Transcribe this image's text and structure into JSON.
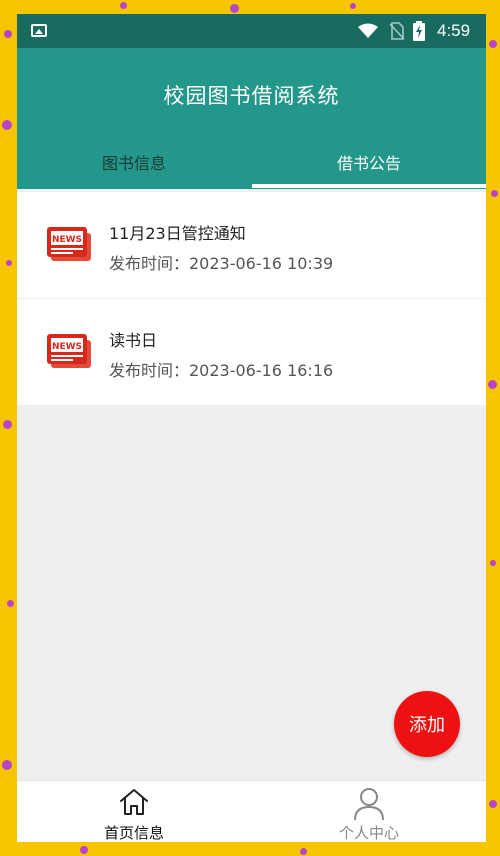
{
  "status_bar": {
    "time": "4:59",
    "icons": [
      "gallery-icon",
      "wifi-icon",
      "no-sim-icon",
      "battery-charging-icon"
    ]
  },
  "app": {
    "title": "校园图书借阅系统"
  },
  "tabs": [
    {
      "label": "图书信息",
      "selected": false
    },
    {
      "label": "借书公告",
      "selected": true
    }
  ],
  "announcements": [
    {
      "title": "11月23日管控通知",
      "publish_time": "发布时间：2023-06-16 10:39",
      "icon": "news-icon"
    },
    {
      "title": "读书日",
      "publish_time": "发布时间：2023-06-16 16:16",
      "icon": "news-icon"
    }
  ],
  "fab": {
    "label": "添加"
  },
  "bottom_nav": [
    {
      "label": "首页信息",
      "icon": "home-icon",
      "selected": true
    },
    {
      "label": "个人中心",
      "icon": "person-icon",
      "selected": false
    }
  ],
  "colors": {
    "status_bar": "#196b60",
    "app_bar": "#23978a",
    "fab": "#ee1111",
    "background_frame": "#f7c400"
  }
}
